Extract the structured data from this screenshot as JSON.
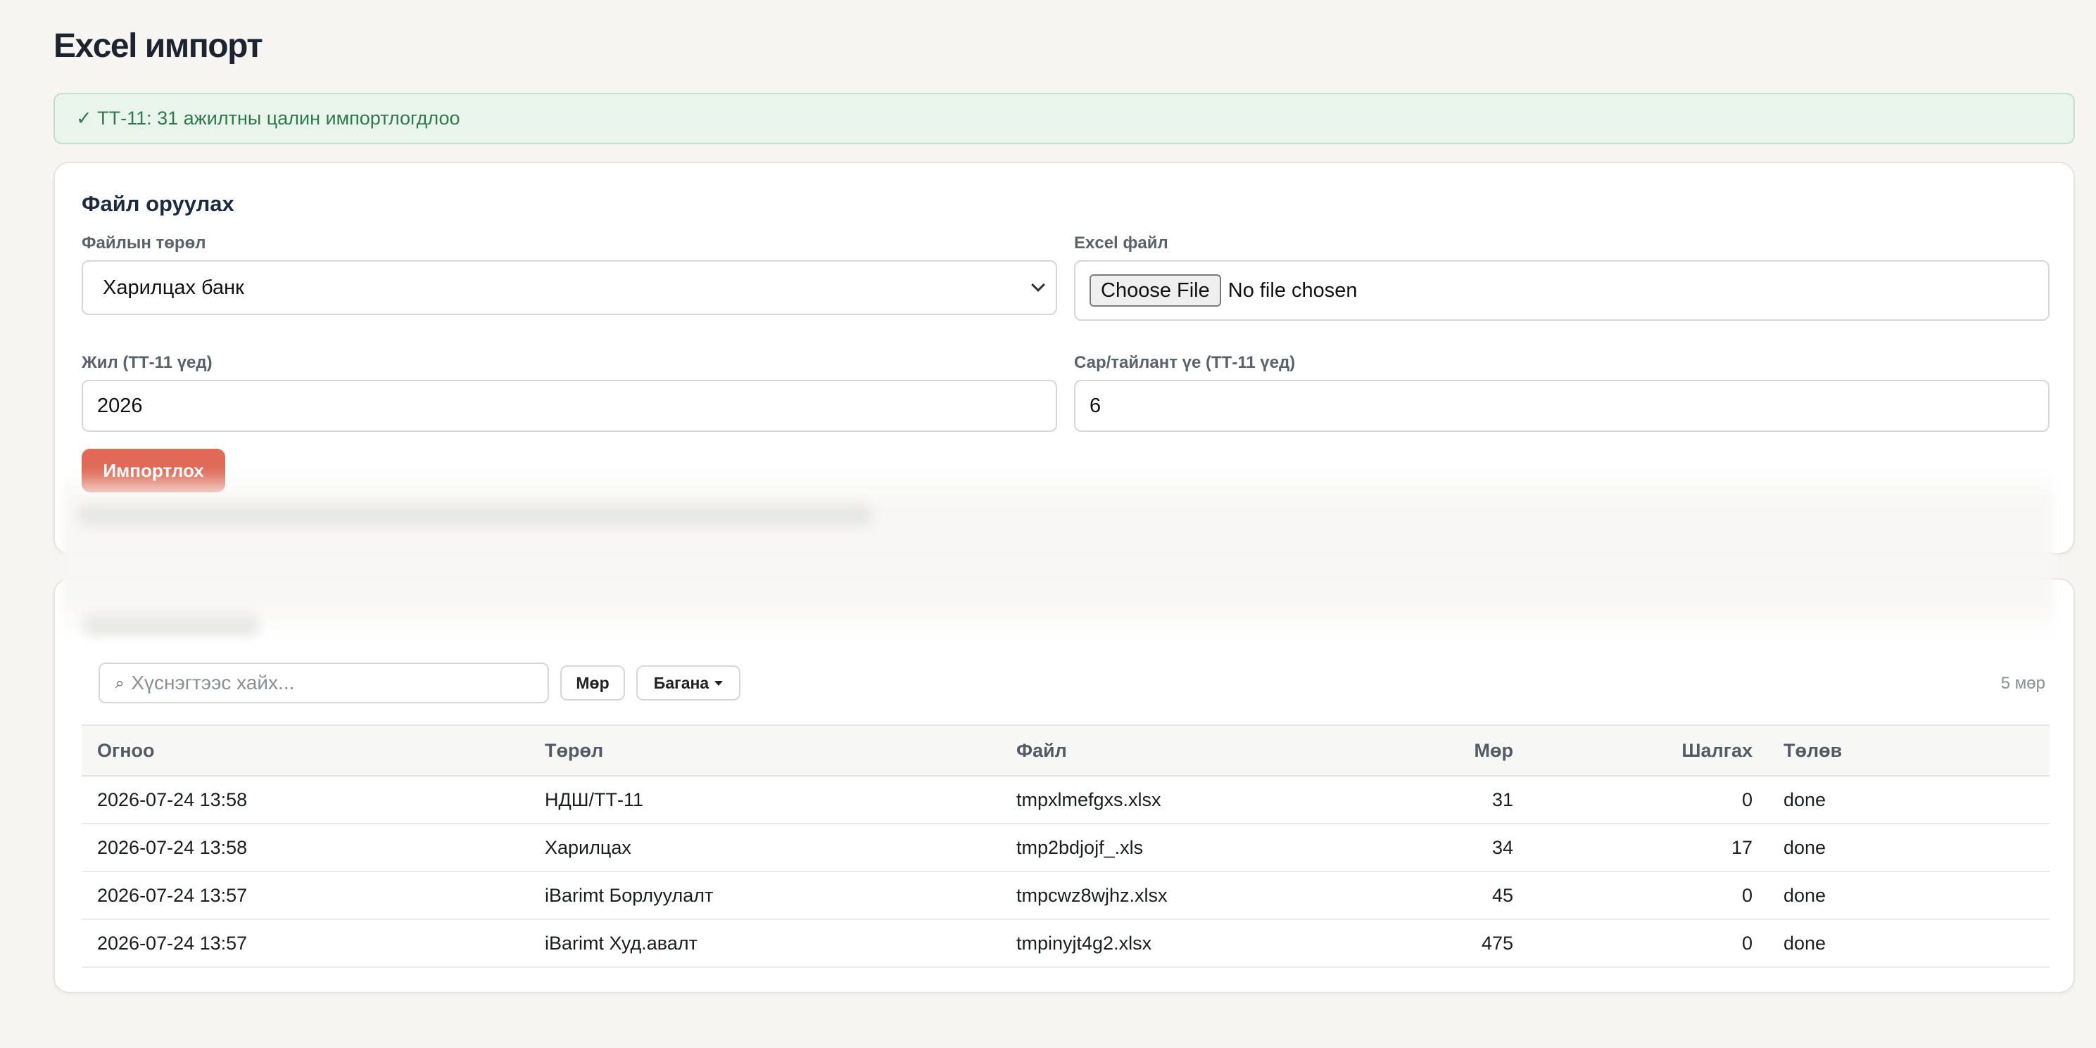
{
  "page": {
    "title": "Excel импорт"
  },
  "alert": {
    "icon": "check-icon",
    "text": "✓ ТТ-11: 31 ажилтны цалин импортлогдлоо"
  },
  "upload": {
    "title": "Файл оруулах",
    "file_type_label": "Файлын төрөл",
    "file_type_value": "Харилцах банк",
    "excel_file_label": "Excel файл",
    "choose_file_button": "Choose File",
    "no_file_text": "No file chosen",
    "year_label": "Жил (ТТ-11 үед)",
    "year_value": "2026",
    "month_label": "Сар/тайлант үе (ТТ-11 үед)",
    "month_value": "6",
    "import_button": "Импортлох"
  },
  "history": {
    "search_placeholder": "Хүснэгтээс хайх...",
    "rows_button": "Мөр",
    "columns_button": "Багана",
    "row_count": "5 мөр",
    "columns": [
      "Огноо",
      "Төрөл",
      "Файл",
      "Мөр",
      "Шалгах",
      "Төлөв"
    ],
    "rows": [
      {
        "date": "2026-07-24 13:58",
        "type": "НДШ/ТТ-11",
        "file": "tmpxlmefgxs.xlsx",
        "rows": "31",
        "check": "0",
        "status": "done"
      },
      {
        "date": "2026-07-24 13:58",
        "type": "Харилцах",
        "file": "tmp2bdjojf_.xls",
        "rows": "34",
        "check": "17",
        "status": "done"
      },
      {
        "date": "2026-07-24 13:57",
        "type": "iBarimt Борлуулалт",
        "file": "tmpcwz8wjhz.xlsx",
        "rows": "45",
        "check": "0",
        "status": "done"
      },
      {
        "date": "2026-07-24 13:57",
        "type": "iBarimt Худ.авалт",
        "file": "tmpinyjt4g2.xlsx",
        "rows": "475",
        "check": "0",
        "status": "done"
      }
    ]
  },
  "colors": {
    "accent": "#e06a57",
    "success_bg": "#e8f4ec",
    "success_text": "#2f7a4c"
  }
}
